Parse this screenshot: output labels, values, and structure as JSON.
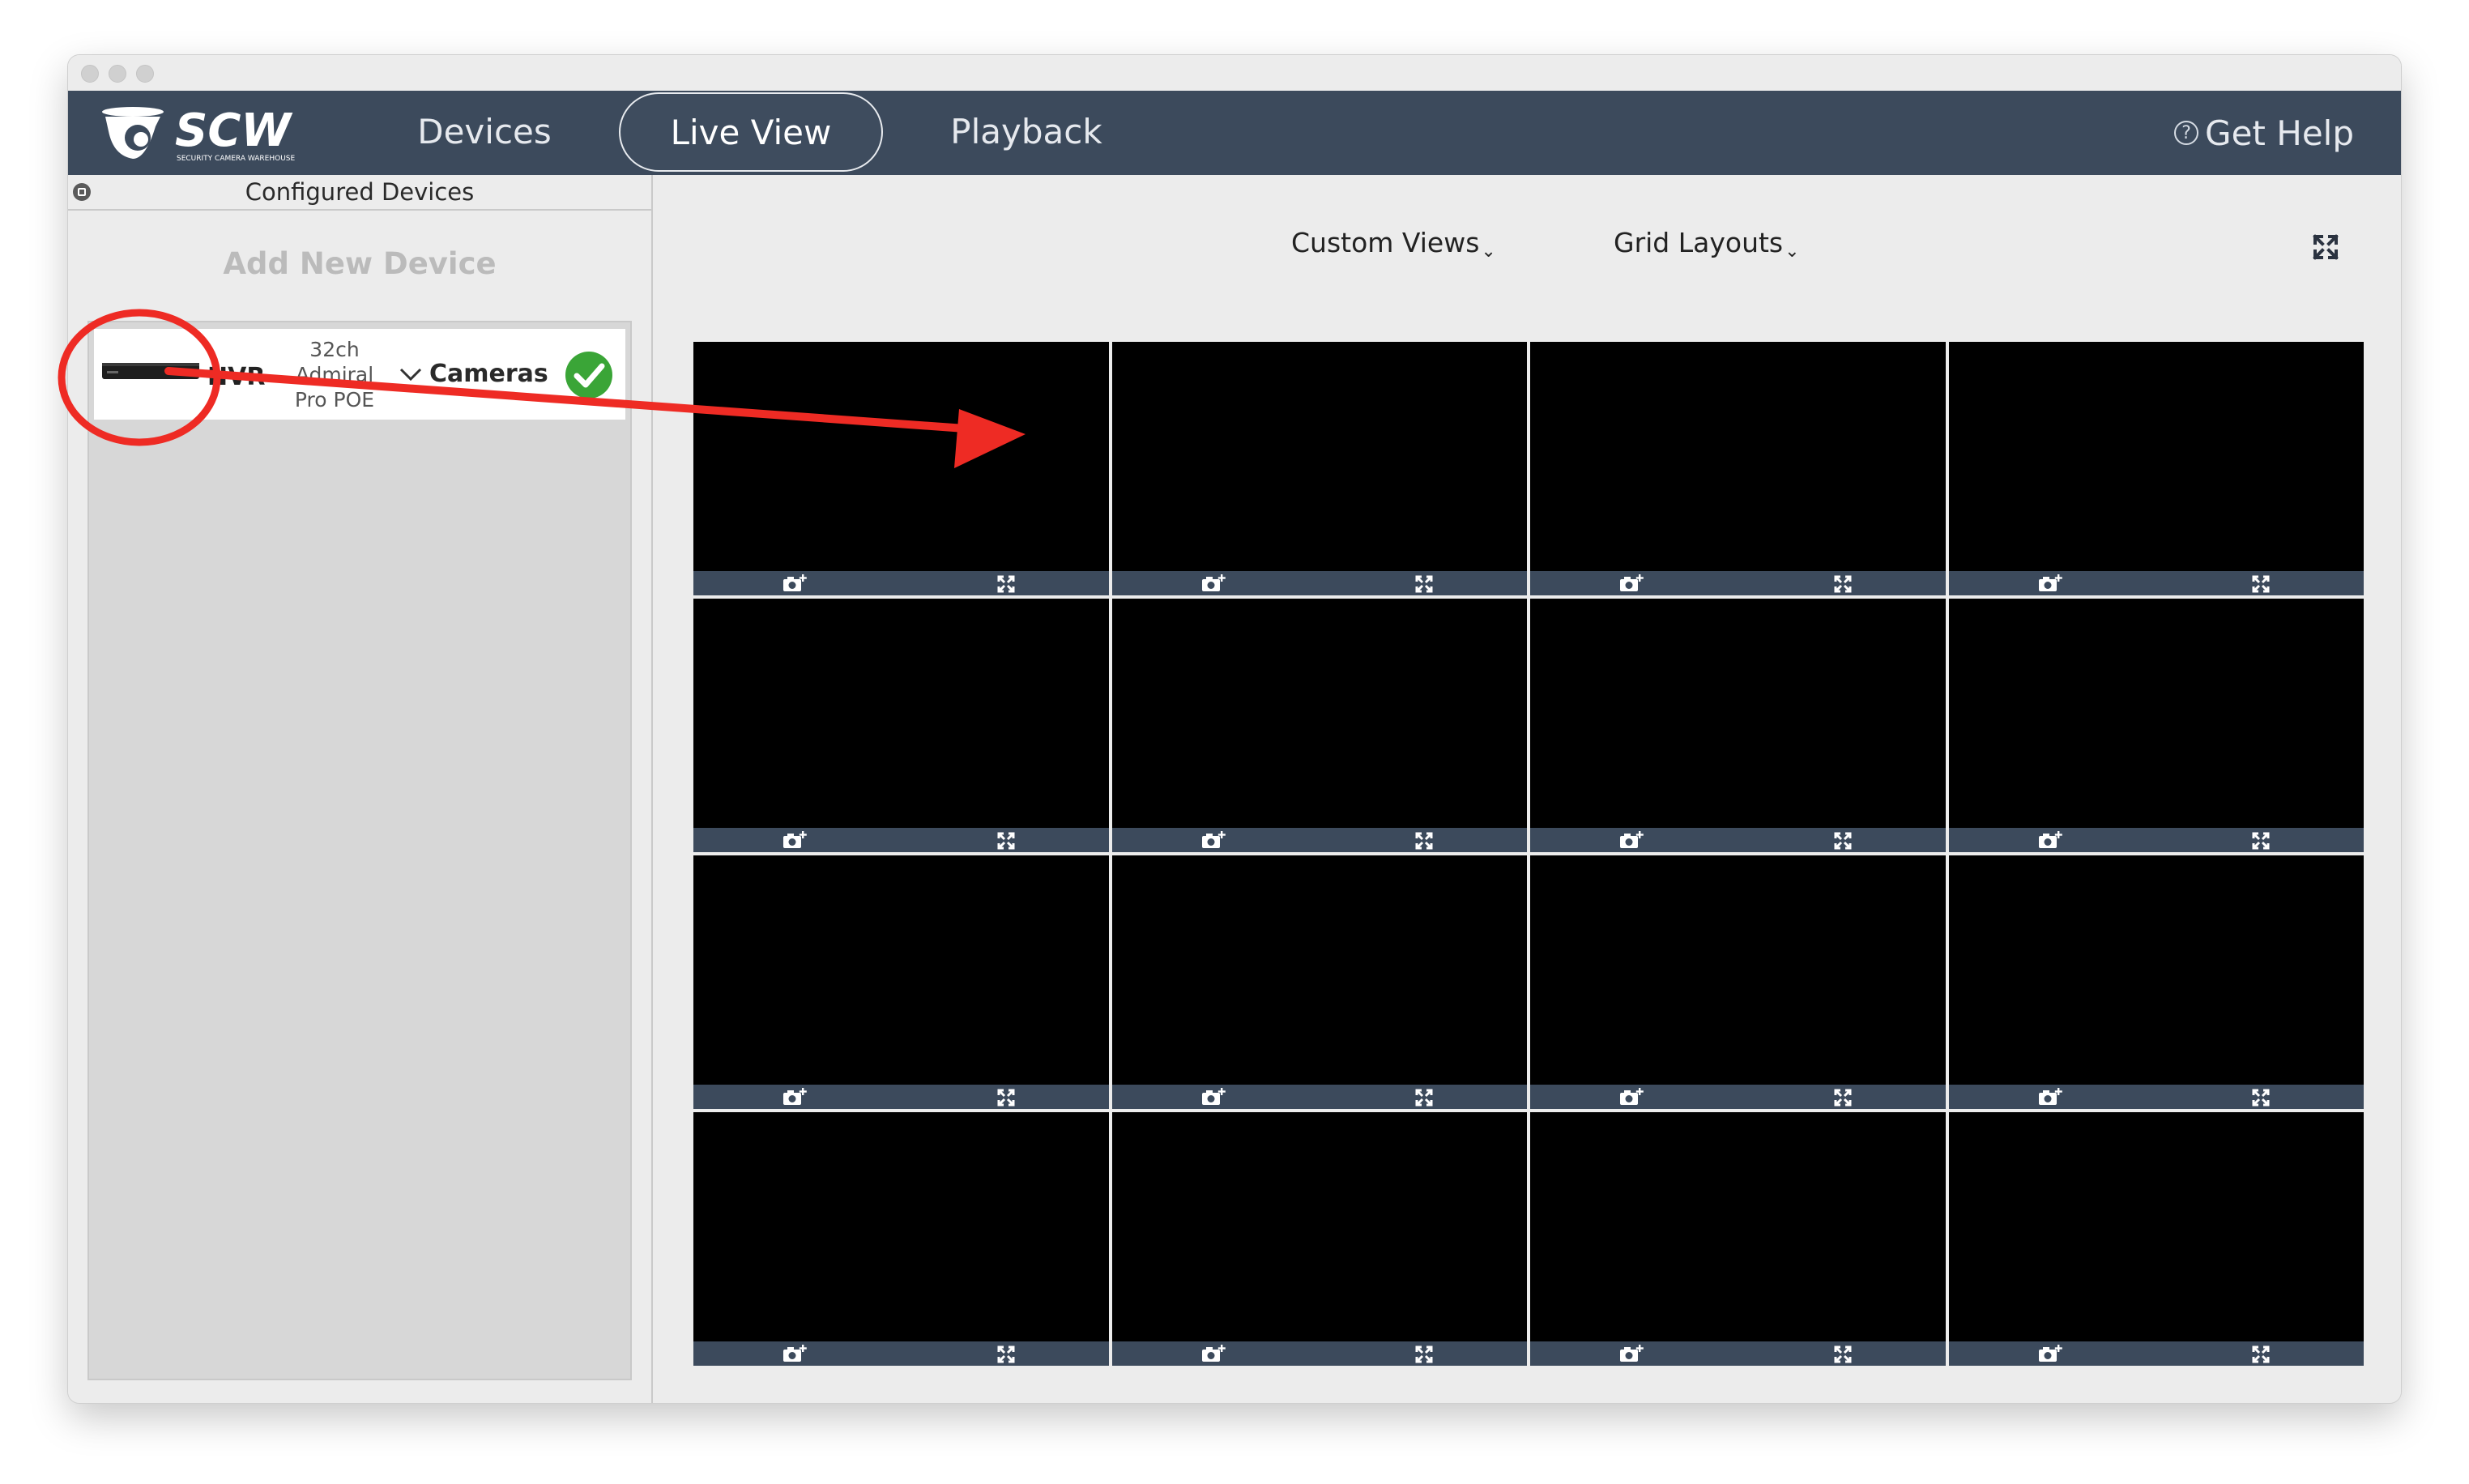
{
  "window": {
    "traffic_lights": [
      "close",
      "minimize",
      "zoom"
    ]
  },
  "navbar": {
    "logo_text": "SCW",
    "logo_tagline": "SECURITY CAMERA WAREHOUSE",
    "tabs": [
      {
        "label": "Devices",
        "active": false
      },
      {
        "label": "Live View",
        "active": true
      },
      {
        "label": "Playback",
        "active": false
      }
    ],
    "help": {
      "icon": "question-circle-icon",
      "label": "Get Help"
    }
  },
  "sidebar": {
    "header_title": "Configured Devices",
    "add_device_label": "Add New Device",
    "devices": [
      {
        "type_label": "NVR",
        "name_lines": [
          "32ch",
          "Admiral",
          "Pro POE"
        ],
        "cameras_label": "Cameras",
        "status": "connected",
        "status_color": "#3aa537"
      }
    ]
  },
  "toolbar": {
    "custom_views_label": "Custom Views",
    "grid_layouts_label": "Grid Layouts",
    "caret": "⌄",
    "fullscreen_icon": "fullscreen-icon"
  },
  "grid": {
    "rows": 4,
    "columns": 4,
    "tile_buttons": [
      "add-camera-icon",
      "expand-icon"
    ]
  },
  "annotation": {
    "color": "#ee2b24",
    "shapes": [
      "circle-highlight",
      "arrow"
    ]
  },
  "colors": {
    "navbar": "#3c4a5c",
    "tile_bar": "#3c4a5c",
    "tile_bg": "#000000"
  }
}
